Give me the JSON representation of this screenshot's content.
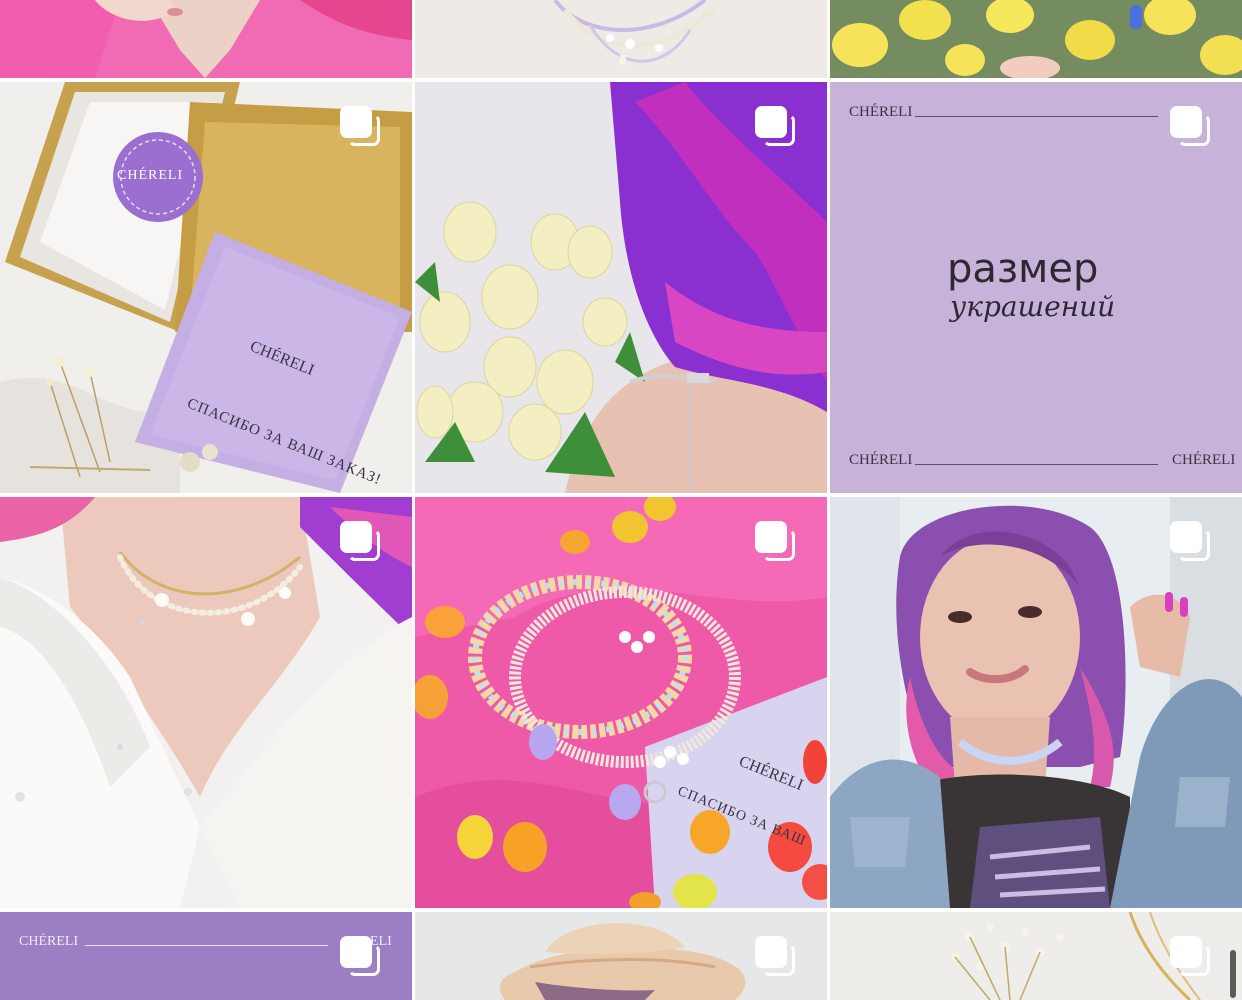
{
  "grid": {
    "posts": [
      {
        "id": "top-left",
        "kind": "photo",
        "scene": "pink-shirt"
      },
      {
        "id": "top-center",
        "kind": "photo",
        "scene": "pearl-necklace"
      },
      {
        "id": "top-right",
        "kind": "photo",
        "scene": "yellow-tulips"
      },
      {
        "id": "r1-left",
        "kind": "photo",
        "scene": "gift-box",
        "sticker_text": "CHÉRELI",
        "card_brand": "CHÉRELI",
        "card_text": "СПАСИБО ЗА ВАШ ЗАКАЗ!"
      },
      {
        "id": "r1-center",
        "kind": "photo",
        "scene": "purple-hair-tulips"
      },
      {
        "id": "r1-right",
        "kind": "graphic",
        "brand": "CHÉRELI",
        "title": "размер",
        "subtitle": "украшений"
      },
      {
        "id": "r2-left",
        "kind": "photo",
        "scene": "pearl-choker"
      },
      {
        "id": "r2-center",
        "kind": "photo",
        "scene": "gummy-bear-necklaces",
        "card_brand": "CHÉRELI",
        "card_text": "СПАСИБО ЗА ВАШ"
      },
      {
        "id": "r2-right",
        "kind": "photo",
        "scene": "selfie-denim"
      },
      {
        "id": "r3-left",
        "kind": "graphic",
        "brand": "CHÉRELI",
        "brand_right": "ELI"
      },
      {
        "id": "r3-center",
        "kind": "photo",
        "scene": "beige-hat"
      },
      {
        "id": "r3-right",
        "kind": "photo",
        "scene": "dried-flowers"
      }
    ]
  },
  "colors": {
    "lavender": "#c7b3d9",
    "purple": "#9b7ec4",
    "pink": "#f25dab",
    "divider": "#ffffff"
  },
  "icons": {
    "multi_post": "carousel-icon"
  }
}
